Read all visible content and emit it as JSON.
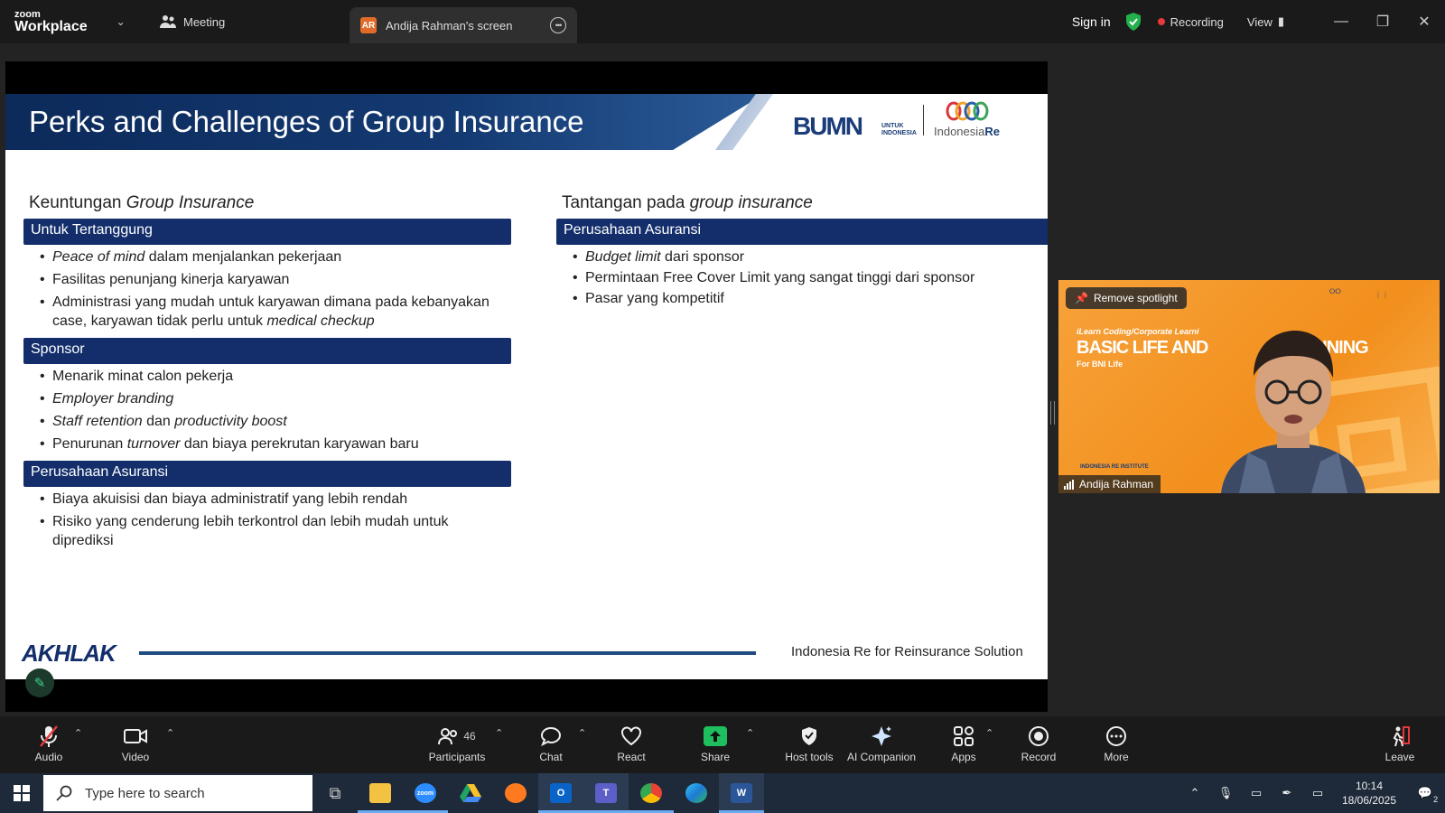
{
  "app": {
    "brand_small": "zoom",
    "brand_main": "Workplace",
    "meeting_tab": "Meeting",
    "screen_tab_badge": "AR",
    "screen_tab": "Andija Rahman's screen",
    "sign_in": "Sign in",
    "recording": "Recording",
    "view": "View"
  },
  "slide": {
    "title": "Perks and Challenges of Group Insurance",
    "logo_bumn": "BUMN",
    "logo_bumn_sub1": "UNTUK",
    "logo_bumn_sub2": "INDONESIA",
    "logo_ire_a": "Indonesia",
    "logo_ire_b": "Re",
    "left": {
      "heading_plain": "Keuntungan ",
      "heading_italic": "Group Insurance",
      "sections": [
        {
          "bar": "Untuk Tertanggung",
          "items": [
            [
              "",
              "Peace of mind",
              " dalam menjalankan pekerjaan"
            ],
            [
              "Fasilitas penunjang kinerja karyawan",
              "",
              ""
            ],
            [
              "Administrasi yang mudah untuk karyawan dimana pada kebanyakan case, karyawan tidak perlu untuk ",
              "medical checkup",
              ""
            ]
          ]
        },
        {
          "bar": "Sponsor",
          "items": [
            [
              "Menarik minat calon pekerja",
              "",
              ""
            ],
            [
              "",
              "Employer branding",
              ""
            ],
            [
              "",
              "Staff retention",
              " dan "
            ],
            [
              "Penurunan ",
              "turnover",
              " dan biaya perekrutan karyawan baru"
            ]
          ]
        },
        {
          "bar": "Perusahaan Asuransi",
          "items": [
            [
              "Biaya akuisisi dan biaya administratif yang lebih rendah",
              "",
              ""
            ],
            [
              "Risiko yang cenderung lebih terkontrol dan lebih mudah untuk diprediksi",
              "",
              ""
            ]
          ]
        }
      ],
      "staff_retention_tail": "productivity boost"
    },
    "right": {
      "heading_plain": "Tantangan pada ",
      "heading_italic": "group insurance",
      "bar": "Perusahaan Asuransi",
      "items": [
        [
          "",
          "Budget limit",
          " dari sponsor"
        ],
        [
          "Permintaan Free Cover Limit yang sangat tinggi dari sponsor",
          "",
          ""
        ],
        [
          "Pasar yang kompetitif",
          "",
          ""
        ]
      ]
    },
    "footer_logo": "AKHLAK",
    "footer_text": "Indonesia Re for Reinsurance Solution"
  },
  "video": {
    "remove_spotlight": "Remove spotlight",
    "participant_name": "Andija Rahman",
    "bg_small": "iLearn Coding/Corporate Learni",
    "bg_big_a": "BASIC LIFE AND",
    "bg_big_b": "RAINING",
    "bg_bni": "For BNI Life",
    "bg_institute": "INDONESIA RE INSTITUTE"
  },
  "toolbar": {
    "audio": "Audio",
    "video": "Video",
    "participants": "Participants",
    "participants_count": "46",
    "chat": "Chat",
    "react": "React",
    "share": "Share",
    "host_tools": "Host tools",
    "ai_companion": "AI Companion",
    "apps": "Apps",
    "record": "Record",
    "more": "More",
    "leave": "Leave"
  },
  "taskbar": {
    "search_placeholder": "Type here to search",
    "time": "10:14",
    "date": "18/06/2025",
    "notification_count": "2"
  },
  "colors": {
    "slide_bar": "#132e6b",
    "recording_dot": "#e5393b",
    "share_green": "#1fbf5f",
    "video_bg": "#f28f1d"
  }
}
